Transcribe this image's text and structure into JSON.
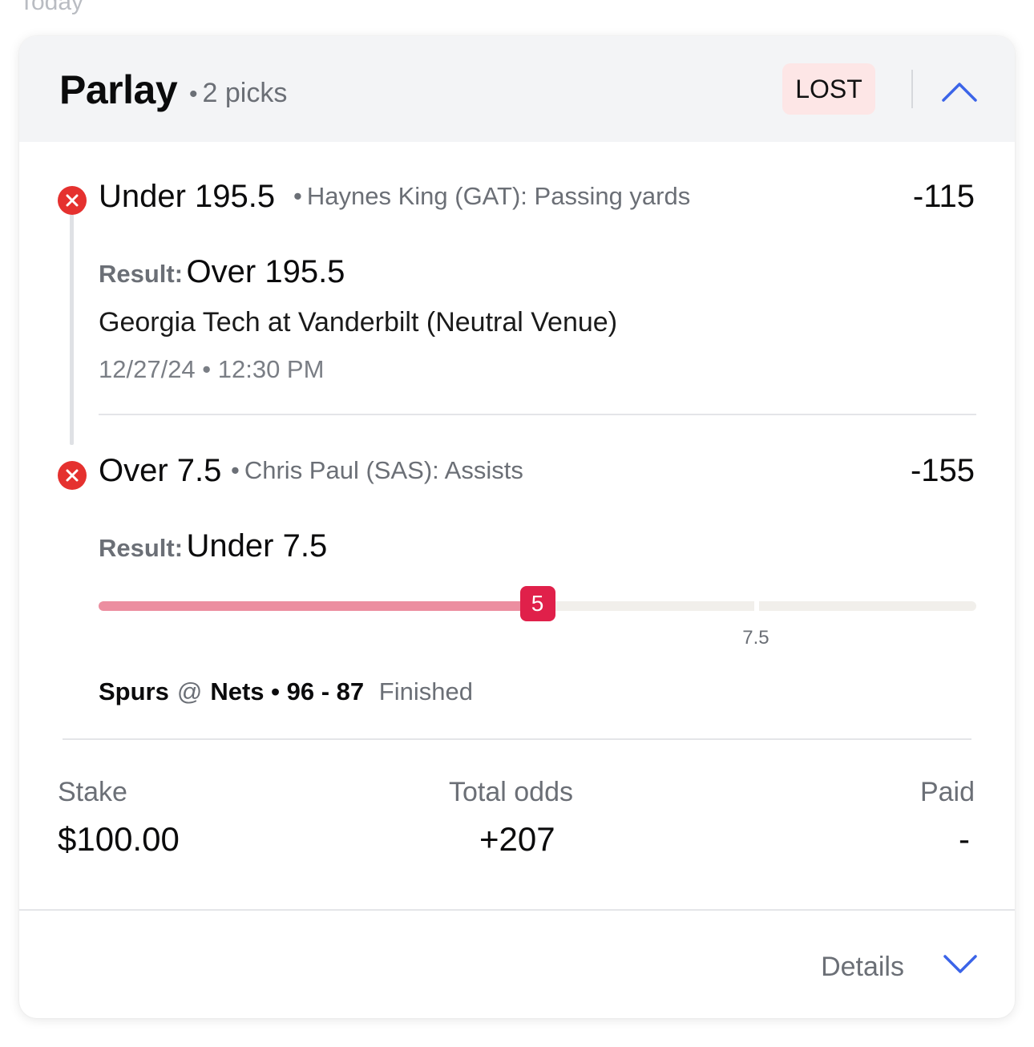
{
  "section": {
    "label": "Today"
  },
  "bet": {
    "type": "Parlay",
    "picks_label": "2 picks",
    "status": "LOST",
    "picks": [
      {
        "selection": "Under 195.5",
        "market": "Haynes King (GAT): Passing yards",
        "odds": "-115",
        "result_label": "Result:",
        "result_value": "Over 195.5",
        "event": "Georgia Tech at Vanderbilt (Neutral Venue)",
        "datetime": "12/27/24 • 12:30 PM"
      },
      {
        "selection": "Over 7.5",
        "market": "Chris Paul (SAS): Assists",
        "odds": "-155",
        "result_label": "Result:",
        "result_value": "Under 7.5",
        "progress": {
          "current": 5,
          "line": 7.5,
          "max": 10,
          "current_label": "5",
          "line_label": "7.5"
        },
        "away_team": "Spurs",
        "at_symbol": "@",
        "home_team": "Nets",
        "score": "• 96 - 87",
        "game_status": "Finished"
      }
    ],
    "summary": {
      "stake_label": "Stake",
      "stake_value": "$100.00",
      "odds_label": "Total odds",
      "odds_value": "+207",
      "paid_label": "Paid",
      "paid_value": "-"
    },
    "details_label": "Details"
  },
  "colors": {
    "loss": "#e5312f",
    "accent": "#3b64e8",
    "badge_bg": "#fde6e6",
    "progress_fill": "#ec8ea0",
    "knob": "#e0204a"
  },
  "icons": [
    "x-circle-icon",
    "chevron-up-icon",
    "chevron-down-icon"
  ]
}
